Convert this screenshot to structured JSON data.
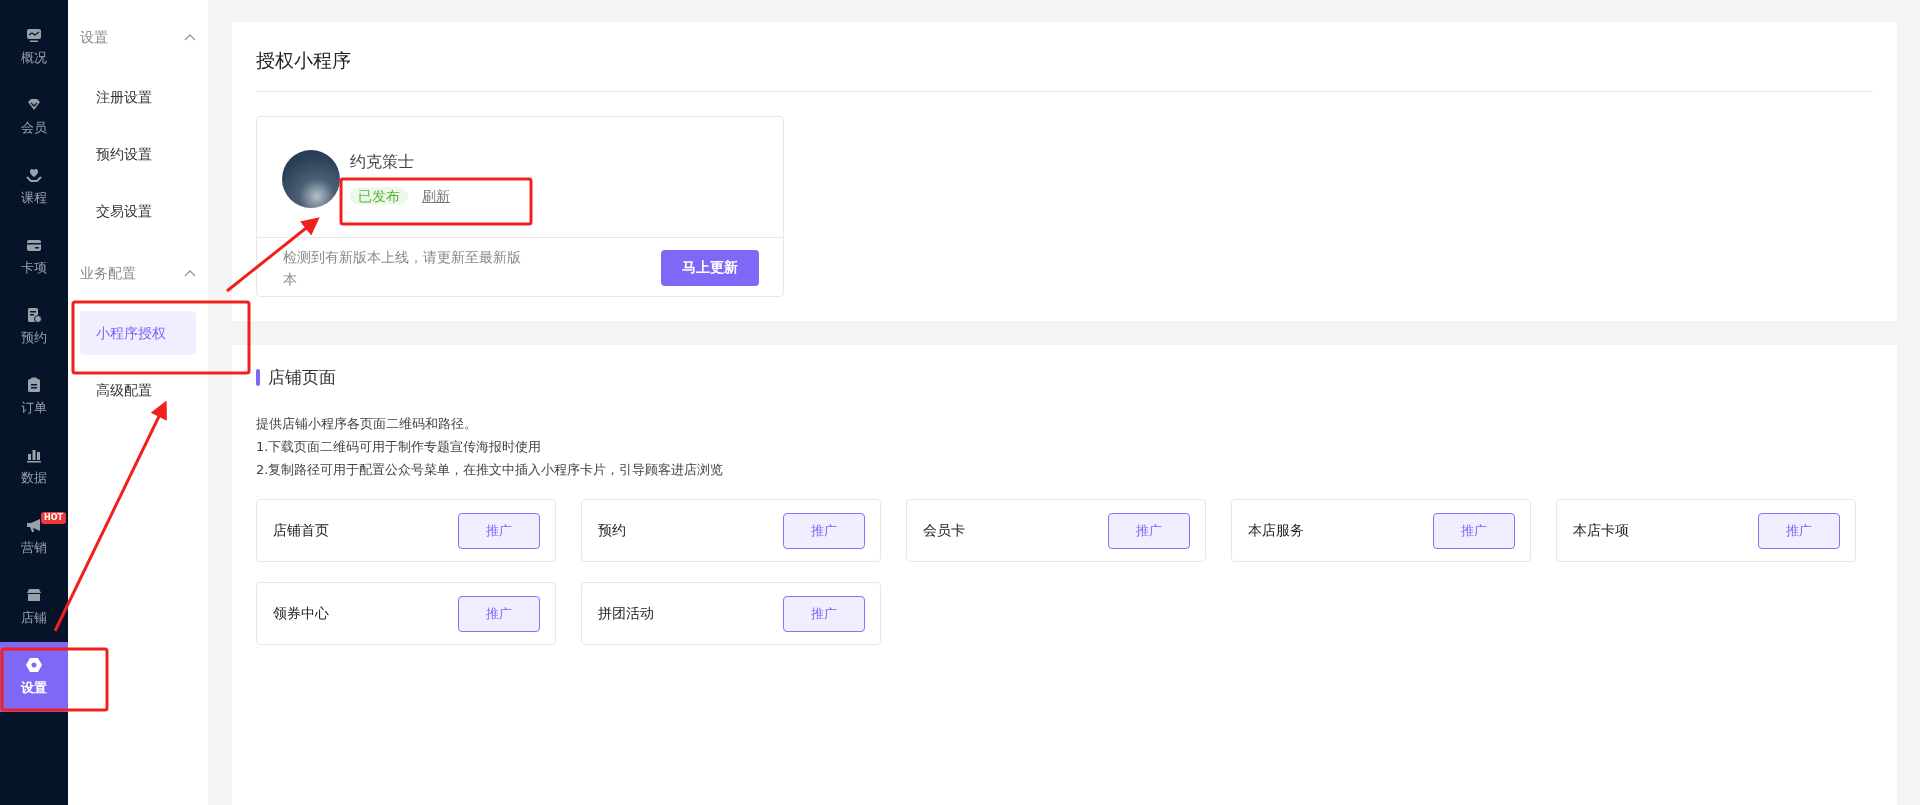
{
  "sidebar": {
    "items": [
      {
        "label": "概况",
        "selected": false
      },
      {
        "label": "会员",
        "selected": false
      },
      {
        "label": "课程",
        "selected": false
      },
      {
        "label": "卡项",
        "selected": false
      },
      {
        "label": "预约",
        "selected": false
      },
      {
        "label": "订单",
        "selected": false
      },
      {
        "label": "数据",
        "selected": false
      },
      {
        "label": "营销",
        "selected": false,
        "badge": "HOT"
      },
      {
        "label": "店铺",
        "selected": false
      },
      {
        "label": "设置",
        "selected": true
      }
    ]
  },
  "submenu": {
    "groups": [
      {
        "title": "设置",
        "expanded": true,
        "items": [
          {
            "label": "注册设置",
            "selected": false
          },
          {
            "label": "预约设置",
            "selected": false
          },
          {
            "label": "交易设置",
            "selected": false
          }
        ]
      },
      {
        "title": "业务配置",
        "expanded": true,
        "items": [
          {
            "label": "小程序授权",
            "selected": true
          },
          {
            "label": "高级配置",
            "selected": false
          }
        ]
      }
    ]
  },
  "auth": {
    "title": "授权小程序",
    "app": {
      "name": "约克策士",
      "status": "已发布",
      "refresh": "刷新"
    },
    "notice": "检测到有新版本上线，请更新至最新版本",
    "update_button": "马上更新"
  },
  "shop": {
    "title": "店铺页面",
    "description": [
      "提供店铺小程序各页面二维码和路径。",
      "1.下载页面二维码可用于制作专题宣传海报时使用",
      "2.复制路径可用于配置公众号菜单，在推文中插入小程序卡片，引导顾客进店浏览"
    ],
    "pages": [
      {
        "name": "店铺首页",
        "button": "推广"
      },
      {
        "name": "预约",
        "button": "推广"
      },
      {
        "name": "会员卡",
        "button": "推广"
      },
      {
        "name": "本店服务",
        "button": "推广"
      },
      {
        "name": "本店卡项",
        "button": "推广"
      },
      {
        "name": "领券中心",
        "button": "推广"
      },
      {
        "name": "拼团活动",
        "button": "推广"
      }
    ]
  }
}
